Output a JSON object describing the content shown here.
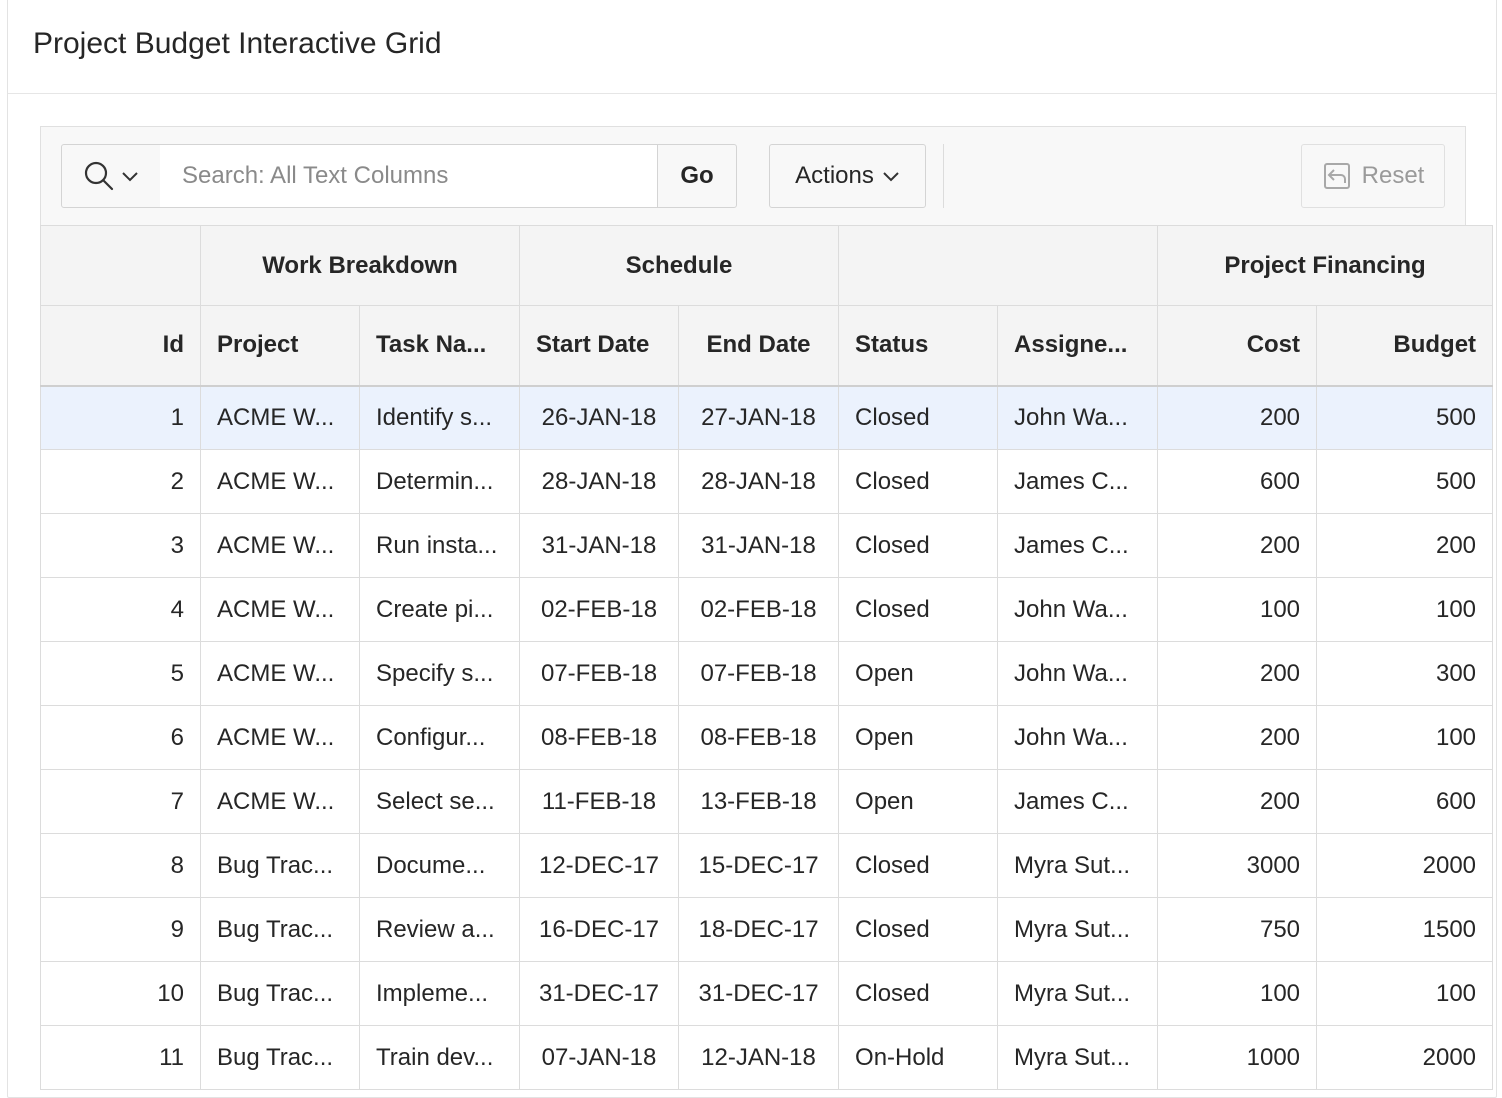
{
  "region": {
    "title": "Project Budget Interactive Grid"
  },
  "toolbar": {
    "search_placeholder": "Search: All Text Columns",
    "go_label": "Go",
    "actions_label": "Actions",
    "reset_label": "Reset"
  },
  "grid": {
    "groups": [
      "",
      "Work Breakdown",
      "Schedule",
      "",
      "Project Financing"
    ],
    "columns": [
      "Id",
      "Project",
      "Task Na...",
      "Start Date",
      "End Date",
      "Status",
      "Assigne...",
      "Cost",
      "Budget"
    ],
    "rows": [
      [
        "1",
        "ACME W...",
        "Identify s...",
        "26-JAN-18",
        "27-JAN-18",
        "Closed",
        "John Wa...",
        "200",
        "500"
      ],
      [
        "2",
        "ACME W...",
        "Determin...",
        "28-JAN-18",
        "28-JAN-18",
        "Closed",
        "James C...",
        "600",
        "500"
      ],
      [
        "3",
        "ACME W...",
        "Run insta...",
        "31-JAN-18",
        "31-JAN-18",
        "Closed",
        "James C...",
        "200",
        "200"
      ],
      [
        "4",
        "ACME W...",
        "Create pi...",
        "02-FEB-18",
        "02-FEB-18",
        "Closed",
        "John Wa...",
        "100",
        "100"
      ],
      [
        "5",
        "ACME W...",
        "Specify s...",
        "07-FEB-18",
        "07-FEB-18",
        "Open",
        "John Wa...",
        "200",
        "300"
      ],
      [
        "6",
        "ACME W...",
        "Configur...",
        "08-FEB-18",
        "08-FEB-18",
        "Open",
        "John Wa...",
        "200",
        "100"
      ],
      [
        "7",
        "ACME W...",
        "Select se...",
        "11-FEB-18",
        "13-FEB-18",
        "Open",
        "James C...",
        "200",
        "600"
      ],
      [
        "8",
        "Bug Trac...",
        "Docume...",
        "12-DEC-17",
        "15-DEC-17",
        "Closed",
        "Myra Sut...",
        "3000",
        "2000"
      ],
      [
        "9",
        "Bug Trac...",
        "Review a...",
        "16-DEC-17",
        "18-DEC-17",
        "Closed",
        "Myra Sut...",
        "750",
        "1500"
      ],
      [
        "10",
        "Bug Trac...",
        "Impleme...",
        "31-DEC-17",
        "31-DEC-17",
        "Closed",
        "Myra Sut...",
        "100",
        "100"
      ],
      [
        "11",
        "Bug Trac...",
        "Train dev...",
        "07-JAN-18",
        "12-JAN-18",
        "On-Hold",
        "Myra Sut...",
        "1000",
        "2000"
      ]
    ]
  },
  "icons": {
    "search_menu": "search-icon",
    "chevron": "chevron-down-icon",
    "reset": "reset-icon"
  },
  "colors": {
    "selected_row": "#ebf2fd",
    "header_bg": "#f4f4f4",
    "toolbar_bg": "#f8f8f8"
  }
}
